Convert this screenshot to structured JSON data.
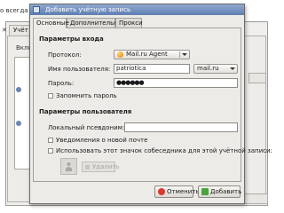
{
  "background": {
    "top_text": "о всегда к",
    "tab_label": "Учёт",
    "close_glyph": "✕",
    "list_header": "Включ"
  },
  "dialog": {
    "title": "Добавить учётную запись",
    "tabs": [
      "Основные",
      "Дополнительные",
      "Прокси"
    ],
    "login_section": "Параметры входа",
    "protocol_label": "Протокол:",
    "protocol_value": "Mail.ru Agent",
    "username_label": "Имя пользователя:",
    "username_value": "patriotica",
    "domain_value": "mail.ru",
    "password_label": "Пароль:",
    "password_value": "●●●●●●",
    "remember_password": "Запомнить пароль",
    "user_section": "Параметры пользователя",
    "alias_label": "Локальный псевдоним:",
    "alias_value": "",
    "new_mail_notify": "Уведомления о новой почте",
    "use_buddy_icon": "Использовать этот значок собеседника для этой учётной записи:",
    "remove_label": "Удалить",
    "cancel_label": "Отменить",
    "add_label": "Добавить"
  },
  "colors": {
    "titlebar": "#6f8cbf",
    "cancel_icon": "#d93a2b",
    "add_icon": "#4aa53a"
  }
}
